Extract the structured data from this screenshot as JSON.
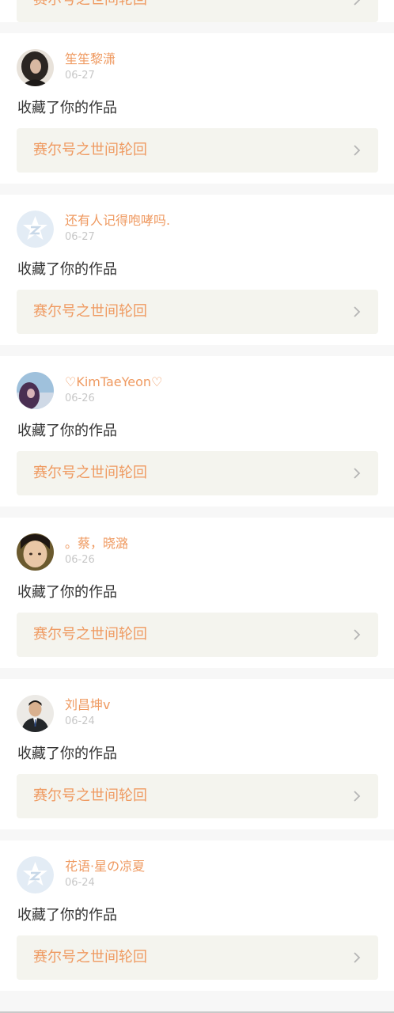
{
  "feed": {
    "items": [
      {
        "work_title": "赛尔号之世间轮回"
      },
      {
        "user_name": "笙笙黎潇",
        "date": "06-27",
        "action": "收藏了你的作品",
        "work_title": "赛尔号之世间轮回",
        "avatar": "photo-dark-hair"
      },
      {
        "user_name": "还有人记得咆哮吗.",
        "date": "06-27",
        "action": "收藏了你的作品",
        "work_title": "赛尔号之世间轮回",
        "avatar": "default-star-avatar"
      },
      {
        "user_name": "♡KimTaeYeon♡",
        "date": "06-26",
        "action": "收藏了你的作品",
        "work_title": "赛尔号之世间轮回",
        "avatar": "photo-sky"
      },
      {
        "user_name": "。蔡，晓潞",
        "date": "06-26",
        "action": "收藏了你的作品",
        "work_title": "赛尔号之世间轮回",
        "avatar": "photo-face"
      },
      {
        "user_name": "刘昌坤v",
        "date": "06-24",
        "action": "收藏了你的作品",
        "work_title": "赛尔号之世间轮回",
        "avatar": "photo-suit"
      },
      {
        "user_name": "花语·星の凉夏",
        "date": "06-24",
        "action": "收藏了你的作品",
        "work_title": "赛尔号之世间轮回",
        "avatar": "default-star-avatar"
      }
    ]
  },
  "colors": {
    "accent": "#ef9a61",
    "link_bg": "#f4f4ee",
    "separator": "#f7f7f7",
    "date_gray": "#c7c7c7",
    "text": "#333333"
  }
}
